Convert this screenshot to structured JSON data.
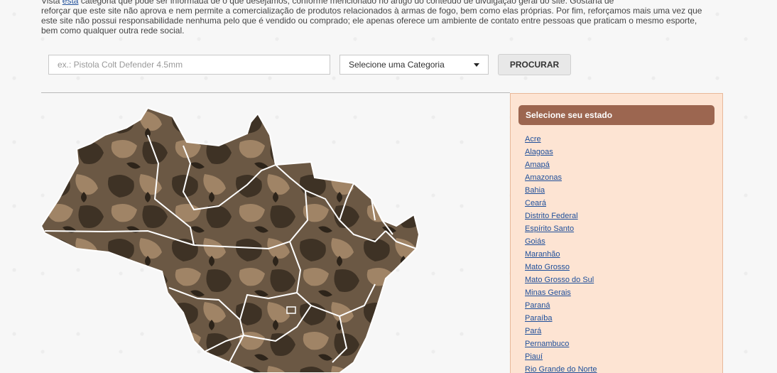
{
  "intro": {
    "line1_pre": "Vista ",
    "line1_link": "esta",
    "line1_post": " categoria que pode ser informada de o que desejamos, conforme mencionado no artigo do conteúdo de divulgação geral do site. Gostaria de",
    "line2": "reforçar que este site não aprova e nem permite a comercialização de produtos relacionados à armas de fogo, bem como elas próprias. Por fim, reforçamos mais uma vez que",
    "line3": "este site não possui responsabilidade nenhuma pelo que é vendido ou comprado; ele apenas oferece um ambiente de contato entre pessoas que praticam o mesmo esporte,",
    "line4": "bem como qualquer outra rede social."
  },
  "search": {
    "placeholder": "ex.: Pistola Colt Defender 4.5mm",
    "value": ""
  },
  "category": {
    "selected": "Selecione uma Categoria"
  },
  "search_button": {
    "label": "PROCURAR"
  },
  "state_panel": {
    "title": "Selecione seu estado",
    "states": [
      "Acre",
      "Alagoas",
      "Amapá",
      "Amazonas",
      "Bahia",
      "Ceará",
      "Distrito Federal",
      "Espírito Santo",
      "Goiás",
      "Maranhão",
      "Mato Grosso",
      "Mato Grosso do Sul",
      "Minas Gerais",
      "Paraná",
      "Paraíba",
      "Pará",
      "Pernambuco",
      "Piauí",
      "Rio Grande do Norte"
    ]
  },
  "colors": {
    "panel_bg": "#fde4d3",
    "panel_header": "#9c6650",
    "link": "#1f4f9a",
    "map_dark": "#3e3225",
    "map_mid": "#6b5844",
    "map_light": "#a08466"
  }
}
